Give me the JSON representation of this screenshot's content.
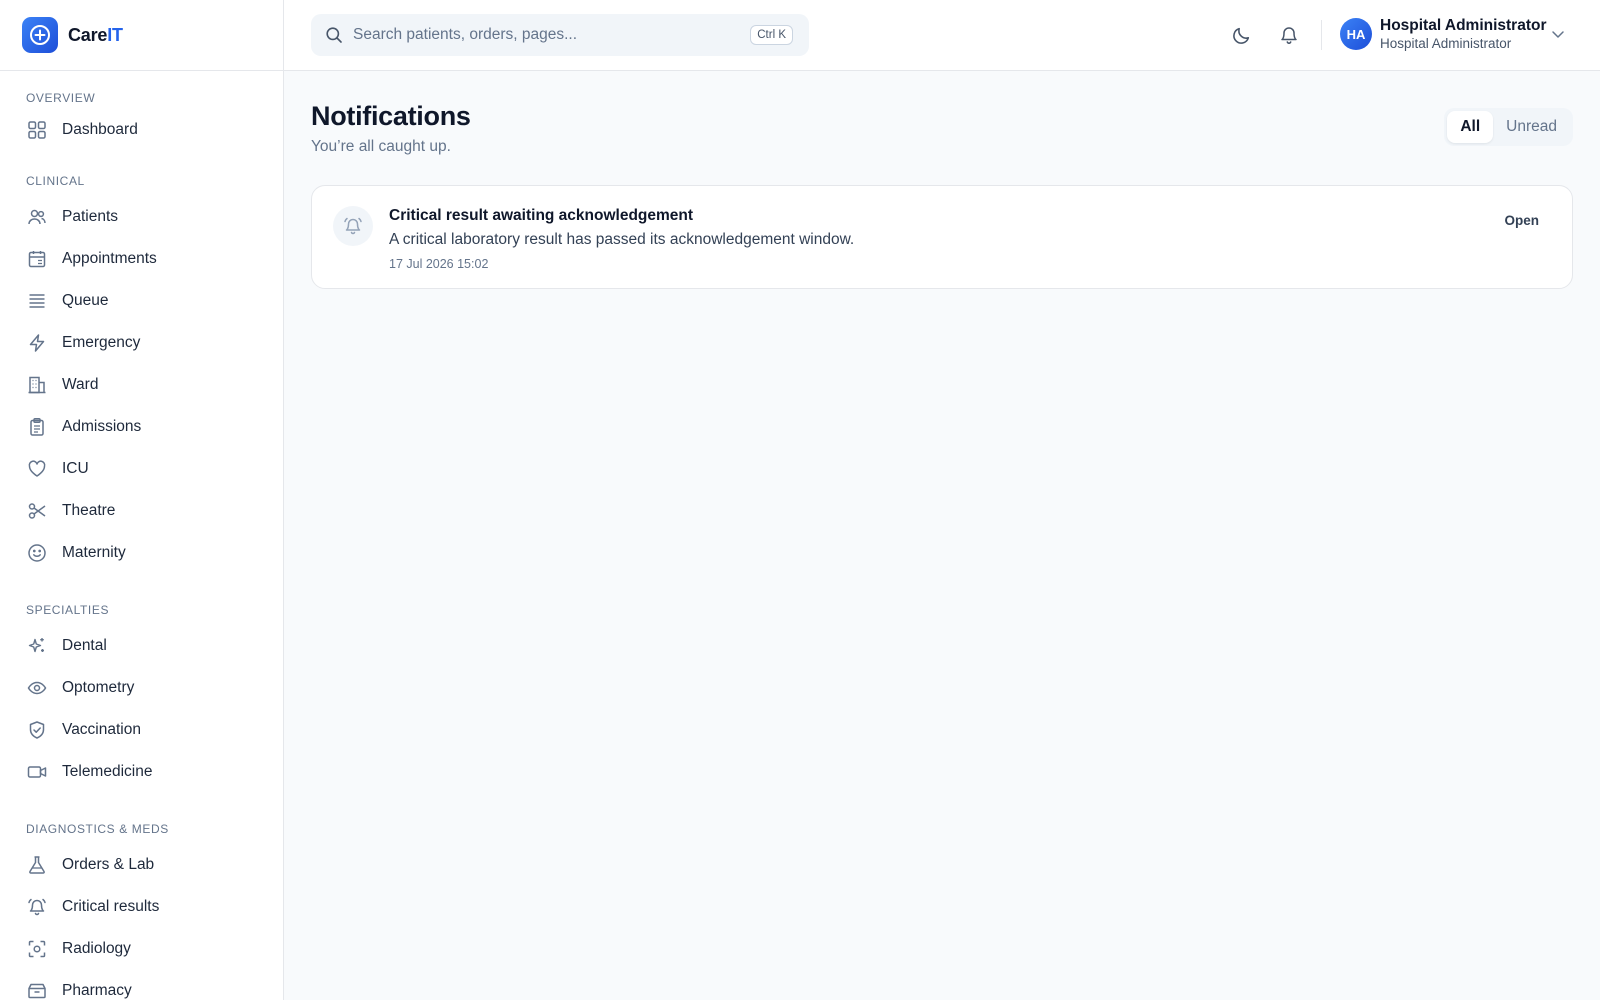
{
  "brand": {
    "name_main": "Care",
    "name_accent": "IT"
  },
  "sidebar": {
    "sections": [
      {
        "label": "Overview",
        "items": [
          {
            "label": "Dashboard",
            "icon": "dashboard-icon"
          }
        ]
      },
      {
        "label": "Clinical",
        "items": [
          {
            "label": "Patients",
            "icon": "users-icon"
          },
          {
            "label": "Appointments",
            "icon": "calendar-icon"
          },
          {
            "label": "Queue",
            "icon": "queue-icon"
          },
          {
            "label": "Emergency",
            "icon": "zap-icon"
          },
          {
            "label": "Ward",
            "icon": "building-icon"
          },
          {
            "label": "Admissions",
            "icon": "clipboard-icon"
          },
          {
            "label": "ICU",
            "icon": "heart-icon"
          },
          {
            "label": "Theatre",
            "icon": "scissors-icon"
          },
          {
            "label": "Maternity",
            "icon": "smile-icon"
          }
        ]
      },
      {
        "label": "Specialties",
        "items": [
          {
            "label": "Dental",
            "icon": "sparkles-icon"
          },
          {
            "label": "Optometry",
            "icon": "eye-icon"
          },
          {
            "label": "Vaccination",
            "icon": "shield-check-icon"
          },
          {
            "label": "Telemedicine",
            "icon": "video-icon"
          }
        ]
      },
      {
        "label": "Diagnostics & Meds",
        "items": [
          {
            "label": "Orders & Lab",
            "icon": "flask-icon"
          },
          {
            "label": "Critical results",
            "icon": "bell-ring-icon"
          },
          {
            "label": "Radiology",
            "icon": "scan-icon"
          },
          {
            "label": "Pharmacy",
            "icon": "pharmacy-icon"
          }
        ]
      }
    ]
  },
  "topbar": {
    "search_placeholder": "Search patients, orders, pages...",
    "search_shortcut": "Ctrl K",
    "user": {
      "initials": "HA",
      "name": "Hospital Administrator",
      "role": "Hospital Administrator"
    }
  },
  "main": {
    "title": "Notifications",
    "subtitle": "You’re all caught up.",
    "filters": [
      {
        "label": "All",
        "active": true
      },
      {
        "label": "Unread",
        "active": false
      }
    ],
    "notifications": [
      {
        "title": "Critical result awaiting acknowledgement",
        "message": "A critical laboratory result has passed its acknowledgement window.",
        "time": "17 Jul 2026 15:02",
        "action": "Open",
        "icon": "bell-ring-icon"
      }
    ]
  },
  "colors": {
    "accent": "#2563eb",
    "background": "#f8fafc",
    "text": "#0f172a",
    "muted": "#64748b"
  }
}
